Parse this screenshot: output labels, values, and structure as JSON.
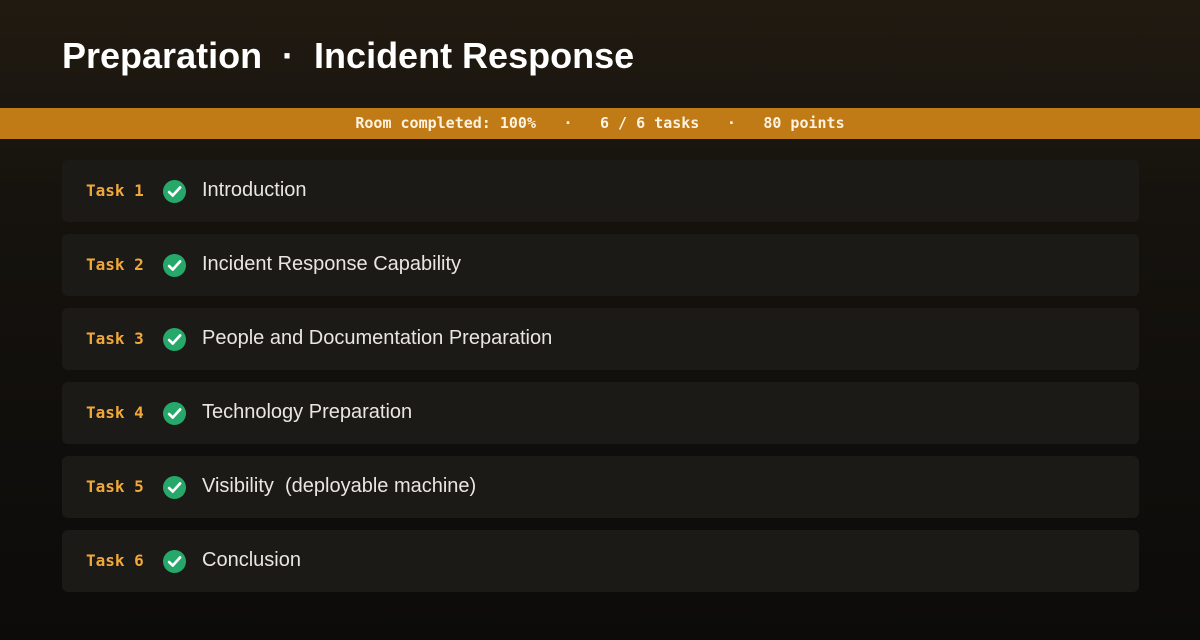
{
  "room": {
    "title": "Preparation  ·  Incident Response"
  },
  "progress": {
    "percent": 100,
    "completed_label": "Room completed: 100%",
    "tasks_label": "6 / 6 tasks",
    "points_label": "80 points",
    "separator": "·"
  },
  "colors": {
    "accent": "#c07a16",
    "task_label": "#f0a83a",
    "check": "#27a86b"
  },
  "tasks": [
    {
      "number": "Task 1",
      "title": "Introduction",
      "status": "completed",
      "icon": "check-circle-icon"
    },
    {
      "number": "Task 2",
      "title": "Incident Response Capability",
      "status": "completed",
      "icon": "check-circle-icon"
    },
    {
      "number": "Task 3",
      "title": "People and Documentation Preparation",
      "status": "completed",
      "icon": "check-circle-icon"
    },
    {
      "number": "Task 4",
      "title": "Technology Preparation",
      "status": "completed",
      "icon": "check-circle-icon"
    },
    {
      "number": "Task 5",
      "title": "Visibility  (deployable machine)",
      "status": "completed",
      "icon": "check-circle-icon"
    },
    {
      "number": "Task 6",
      "title": "Conclusion",
      "status": "completed",
      "icon": "check-circle-icon"
    }
  ]
}
